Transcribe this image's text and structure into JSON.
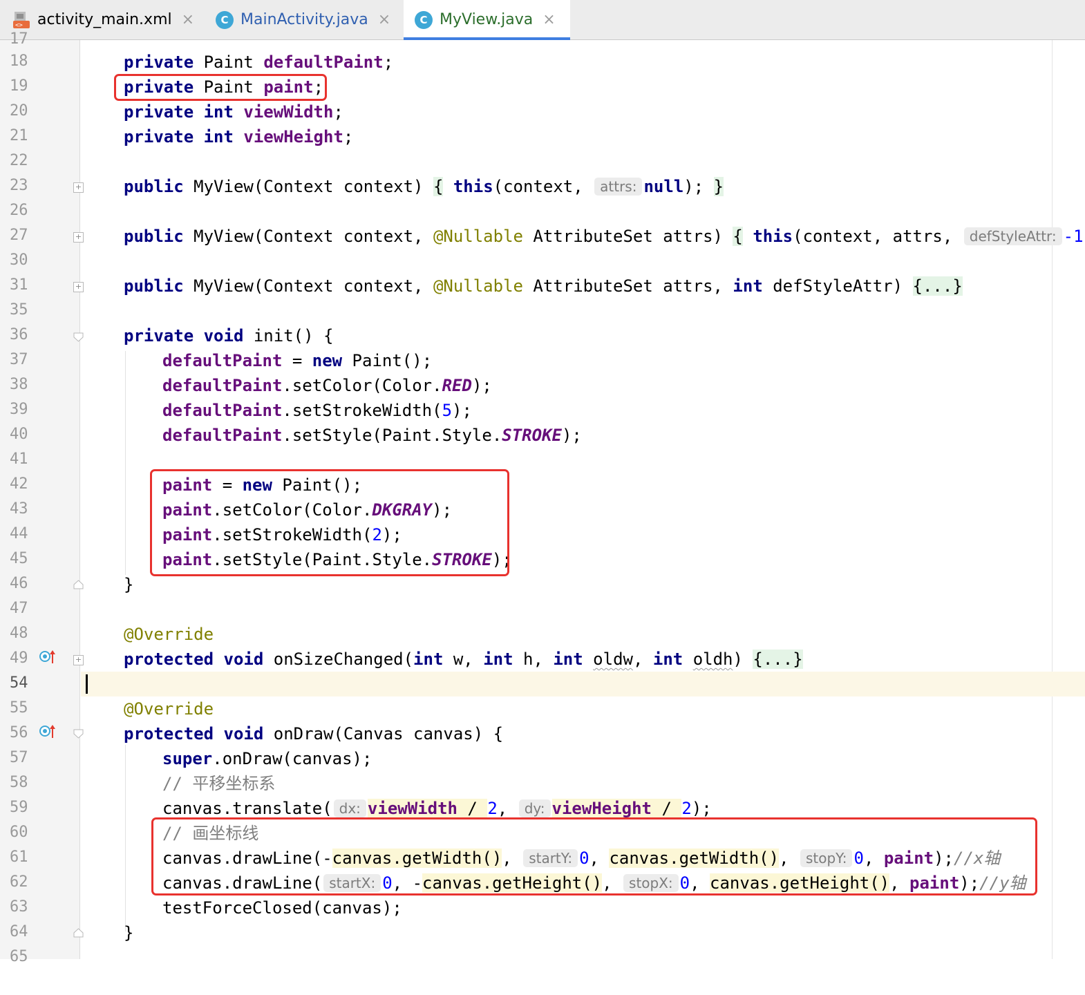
{
  "tabs": [
    {
      "name": "activity_main.xml",
      "close": "×",
      "icon": "xml-layout-icon"
    },
    {
      "name": "MainActivity.java",
      "close": "×",
      "icon": "class-c-icon",
      "icon_letter": "C"
    },
    {
      "name": "MyView.java",
      "close": "×",
      "icon": "class-c-icon",
      "icon_letter": "C",
      "active": true
    }
  ],
  "colors": {
    "accent": "#3f7ee0",
    "keyword": "#000080",
    "field": "#660e7a",
    "number": "#0000ff",
    "annotation": "#808000",
    "comment": "#808080",
    "highlight_box": "#e8322e"
  },
  "editor": {
    "line_numbers": [
      "17",
      "18",
      "19",
      "20",
      "21",
      "22",
      "23",
      "26",
      "27",
      "30",
      "31",
      "35",
      "36",
      "37",
      "38",
      "39",
      "40",
      "41",
      "42",
      "43",
      "44",
      "45",
      "46",
      "47",
      "48",
      "49",
      "54",
      "55",
      "56",
      "57",
      "58",
      "59",
      "60",
      "61",
      "62",
      "63",
      "64",
      "65"
    ],
    "current_line": "54",
    "gutter_icons": {
      "49": "override-method-icon",
      "56": "override-method-icon"
    },
    "code": {
      "l18_kw": "private",
      "l18_type": " Paint ",
      "l18_field": "defaultPaint",
      "l18_end": ";",
      "l19_kw": "private",
      "l19_type": " Paint ",
      "l19_field": "paint",
      "l19_end": ";",
      "l20_kw1": "private",
      "l20_kw2": " int ",
      "l20_field": "viewWidth",
      "l20_end": ";",
      "l21_kw1": "private",
      "l21_kw2": " int ",
      "l21_field": "viewHeight",
      "l21_end": ";",
      "l23_kw": "public",
      "l23_sig": " MyView(Context context) ",
      "l23_open": "{",
      "l23_this": "this",
      "l23_args": "(context, ",
      "l23_hint": "attrs:",
      "l23_null": "null",
      "l23_end": "); ",
      "l23_close": "}",
      "l27_kw": "public",
      "l27_a": " MyView(Context context, ",
      "l27_ann": "@Nullable",
      "l27_b": " AttributeSet attrs) ",
      "l27_open": "{",
      "l27_this": "this",
      "l27_args": "(context, attrs, ",
      "l27_hint": "defStyleAttr:",
      "l27_num": "-1",
      "l27_end": ")",
      "l31_kw": "public",
      "l31_a": " MyView(Context context, ",
      "l31_ann": "@Nullable",
      "l31_b": " AttributeSet attrs, ",
      "l31_int": "int",
      "l31_c": " defStyleAttr) ",
      "l31_fold": "{...}",
      "l36_kw1": "private",
      "l36_kw2": " void",
      "l36_rest": " init() {",
      "l37_field": "defaultPaint",
      "l37_eq": " = ",
      "l37_new": "new",
      "l37_rest": " Paint();",
      "l38_field": "defaultPaint",
      "l38_a": ".setColor(Color.",
      "l38_const": "RED",
      "l38_end": ");",
      "l39_field": "defaultPaint",
      "l39_a": ".setStrokeWidth(",
      "l39_num": "5",
      "l39_end": ");",
      "l40_field": "defaultPaint",
      "l40_a": ".setStyle(Paint.Style.",
      "l40_const": "STROKE",
      "l40_end": ");",
      "l42_field": "paint",
      "l42_eq": " = ",
      "l42_new": "new",
      "l42_rest": " Paint();",
      "l43_field": "paint",
      "l43_a": ".setColor(Color.",
      "l43_const": "DKGRAY",
      "l43_end": ");",
      "l44_field": "paint",
      "l44_a": ".setStrokeWidth(",
      "l44_num": "2",
      "l44_end": ");",
      "l45_field": "paint",
      "l45_a": ".setStyle(Paint.Style.",
      "l45_const": "STROKE",
      "l45_end": ");",
      "l46_close": "}",
      "l48_ann": "@Override",
      "l49_kw1": "protected",
      "l49_kw2": " void",
      "l49_a": " onSizeChanged(",
      "l49_int1": "int",
      "l49_b": " w, ",
      "l49_int2": "int",
      "l49_c": " h, ",
      "l49_int3": "int",
      "l49_d": " ",
      "l49_oldw": "oldw",
      "l49_e": ", ",
      "l49_int4": "int",
      "l49_f": " ",
      "l49_oldh": "oldh",
      "l49_g": ") ",
      "l49_fold": "{...}",
      "l55_ann": "@Override",
      "l56_kw1": "protected",
      "l56_kw2": " void",
      "l56_rest": " onDraw(Canvas canvas) {",
      "l57_super": "super",
      "l57_rest": ".onDraw(canvas);",
      "l58_cmt": "// 平移坐标系",
      "l59_a": "canvas.translate(",
      "l59_hint1": "dx:",
      "l59_f1": "viewWidth",
      "l59_op1": " / ",
      "l59_n1": "2",
      "l59_sep": ", ",
      "l59_hint2": "dy:",
      "l59_f2": "viewHeight",
      "l59_op2": " / ",
      "l59_n2": "2",
      "l59_end": ");",
      "l60_cmt": "// 画坐标线",
      "l61_a": "canvas.drawLine(-",
      "l61_c1": "canvas.getWidth()",
      "l61_s1": ", ",
      "l61_hint1": "startY:",
      "l61_n1": "0",
      "l61_s2": ", ",
      "l61_c2": "canvas.getWidth()",
      "l61_s3": ", ",
      "l61_hint2": "stopY:",
      "l61_n2": "0",
      "l61_s4": ", ",
      "l61_paint": "paint",
      "l61_end": ");",
      "l61_cmt": "//x轴",
      "l62_a": "canvas.drawLine(",
      "l62_hint1": "startX:",
      "l62_n1": "0",
      "l62_s1": ", -",
      "l62_c1": "canvas.getHeight()",
      "l62_s2": ", ",
      "l62_hint2": "stopX:",
      "l62_n2": "0",
      "l62_s3": ", ",
      "l62_c2": "canvas.getHeight()",
      "l62_s4": ", ",
      "l62_paint": "paint",
      "l62_end": ");",
      "l62_cmt": "//y轴",
      "l63_text": "testForceClosed(canvas);",
      "l64_close": "}"
    }
  }
}
